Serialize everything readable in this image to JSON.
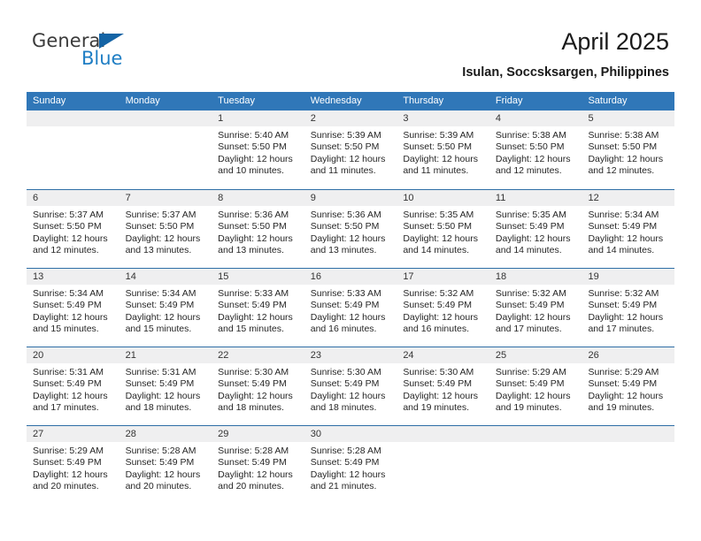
{
  "logo": {
    "primary_text": "General",
    "secondary_text": "Blue",
    "primary_color": "#3b3b3b",
    "secondary_color": "#1f7ec4",
    "triangle_color": "#1464a5"
  },
  "header": {
    "title": "April 2025",
    "subtitle": "Isulan, Soccsksargen, Philippines"
  },
  "theme": {
    "header_row_bg": "#3077b8",
    "header_row_text": "#ffffff",
    "week_divider": "#2e6ea6",
    "daynum_bg": "#efeff0",
    "cell_bg": "#ffffff"
  },
  "calendar": {
    "weekday_headers": [
      "Sunday",
      "Monday",
      "Tuesday",
      "Wednesday",
      "Thursday",
      "Friday",
      "Saturday"
    ],
    "weeks": [
      [
        {
          "day": "",
          "sunrise": "",
          "sunset": "",
          "daylight": "",
          "daylight2": ""
        },
        {
          "day": "",
          "sunrise": "",
          "sunset": "",
          "daylight": "",
          "daylight2": ""
        },
        {
          "day": "1",
          "sunrise": "Sunrise: 5:40 AM",
          "sunset": "Sunset: 5:50 PM",
          "daylight": "Daylight: 12 hours",
          "daylight2": "and 10 minutes."
        },
        {
          "day": "2",
          "sunrise": "Sunrise: 5:39 AM",
          "sunset": "Sunset: 5:50 PM",
          "daylight": "Daylight: 12 hours",
          "daylight2": "and 11 minutes."
        },
        {
          "day": "3",
          "sunrise": "Sunrise: 5:39 AM",
          "sunset": "Sunset: 5:50 PM",
          "daylight": "Daylight: 12 hours",
          "daylight2": "and 11 minutes."
        },
        {
          "day": "4",
          "sunrise": "Sunrise: 5:38 AM",
          "sunset": "Sunset: 5:50 PM",
          "daylight": "Daylight: 12 hours",
          "daylight2": "and 12 minutes."
        },
        {
          "day": "5",
          "sunrise": "Sunrise: 5:38 AM",
          "sunset": "Sunset: 5:50 PM",
          "daylight": "Daylight: 12 hours",
          "daylight2": "and 12 minutes."
        }
      ],
      [
        {
          "day": "6",
          "sunrise": "Sunrise: 5:37 AM",
          "sunset": "Sunset: 5:50 PM",
          "daylight": "Daylight: 12 hours",
          "daylight2": "and 12 minutes."
        },
        {
          "day": "7",
          "sunrise": "Sunrise: 5:37 AM",
          "sunset": "Sunset: 5:50 PM",
          "daylight": "Daylight: 12 hours",
          "daylight2": "and 13 minutes."
        },
        {
          "day": "8",
          "sunrise": "Sunrise: 5:36 AM",
          "sunset": "Sunset: 5:50 PM",
          "daylight": "Daylight: 12 hours",
          "daylight2": "and 13 minutes."
        },
        {
          "day": "9",
          "sunrise": "Sunrise: 5:36 AM",
          "sunset": "Sunset: 5:50 PM",
          "daylight": "Daylight: 12 hours",
          "daylight2": "and 13 minutes."
        },
        {
          "day": "10",
          "sunrise": "Sunrise: 5:35 AM",
          "sunset": "Sunset: 5:50 PM",
          "daylight": "Daylight: 12 hours",
          "daylight2": "and 14 minutes."
        },
        {
          "day": "11",
          "sunrise": "Sunrise: 5:35 AM",
          "sunset": "Sunset: 5:49 PM",
          "daylight": "Daylight: 12 hours",
          "daylight2": "and 14 minutes."
        },
        {
          "day": "12",
          "sunrise": "Sunrise: 5:34 AM",
          "sunset": "Sunset: 5:49 PM",
          "daylight": "Daylight: 12 hours",
          "daylight2": "and 14 minutes."
        }
      ],
      [
        {
          "day": "13",
          "sunrise": "Sunrise: 5:34 AM",
          "sunset": "Sunset: 5:49 PM",
          "daylight": "Daylight: 12 hours",
          "daylight2": "and 15 minutes."
        },
        {
          "day": "14",
          "sunrise": "Sunrise: 5:34 AM",
          "sunset": "Sunset: 5:49 PM",
          "daylight": "Daylight: 12 hours",
          "daylight2": "and 15 minutes."
        },
        {
          "day": "15",
          "sunrise": "Sunrise: 5:33 AM",
          "sunset": "Sunset: 5:49 PM",
          "daylight": "Daylight: 12 hours",
          "daylight2": "and 15 minutes."
        },
        {
          "day": "16",
          "sunrise": "Sunrise: 5:33 AM",
          "sunset": "Sunset: 5:49 PM",
          "daylight": "Daylight: 12 hours",
          "daylight2": "and 16 minutes."
        },
        {
          "day": "17",
          "sunrise": "Sunrise: 5:32 AM",
          "sunset": "Sunset: 5:49 PM",
          "daylight": "Daylight: 12 hours",
          "daylight2": "and 16 minutes."
        },
        {
          "day": "18",
          "sunrise": "Sunrise: 5:32 AM",
          "sunset": "Sunset: 5:49 PM",
          "daylight": "Daylight: 12 hours",
          "daylight2": "and 17 minutes."
        },
        {
          "day": "19",
          "sunrise": "Sunrise: 5:32 AM",
          "sunset": "Sunset: 5:49 PM",
          "daylight": "Daylight: 12 hours",
          "daylight2": "and 17 minutes."
        }
      ],
      [
        {
          "day": "20",
          "sunrise": "Sunrise: 5:31 AM",
          "sunset": "Sunset: 5:49 PM",
          "daylight": "Daylight: 12 hours",
          "daylight2": "and 17 minutes."
        },
        {
          "day": "21",
          "sunrise": "Sunrise: 5:31 AM",
          "sunset": "Sunset: 5:49 PM",
          "daylight": "Daylight: 12 hours",
          "daylight2": "and 18 minutes."
        },
        {
          "day": "22",
          "sunrise": "Sunrise: 5:30 AM",
          "sunset": "Sunset: 5:49 PM",
          "daylight": "Daylight: 12 hours",
          "daylight2": "and 18 minutes."
        },
        {
          "day": "23",
          "sunrise": "Sunrise: 5:30 AM",
          "sunset": "Sunset: 5:49 PM",
          "daylight": "Daylight: 12 hours",
          "daylight2": "and 18 minutes."
        },
        {
          "day": "24",
          "sunrise": "Sunrise: 5:30 AM",
          "sunset": "Sunset: 5:49 PM",
          "daylight": "Daylight: 12 hours",
          "daylight2": "and 19 minutes."
        },
        {
          "day": "25",
          "sunrise": "Sunrise: 5:29 AM",
          "sunset": "Sunset: 5:49 PM",
          "daylight": "Daylight: 12 hours",
          "daylight2": "and 19 minutes."
        },
        {
          "day": "26",
          "sunrise": "Sunrise: 5:29 AM",
          "sunset": "Sunset: 5:49 PM",
          "daylight": "Daylight: 12 hours",
          "daylight2": "and 19 minutes."
        }
      ],
      [
        {
          "day": "27",
          "sunrise": "Sunrise: 5:29 AM",
          "sunset": "Sunset: 5:49 PM",
          "daylight": "Daylight: 12 hours",
          "daylight2": "and 20 minutes."
        },
        {
          "day": "28",
          "sunrise": "Sunrise: 5:28 AM",
          "sunset": "Sunset: 5:49 PM",
          "daylight": "Daylight: 12 hours",
          "daylight2": "and 20 minutes."
        },
        {
          "day": "29",
          "sunrise": "Sunrise: 5:28 AM",
          "sunset": "Sunset: 5:49 PM",
          "daylight": "Daylight: 12 hours",
          "daylight2": "and 20 minutes."
        },
        {
          "day": "30",
          "sunrise": "Sunrise: 5:28 AM",
          "sunset": "Sunset: 5:49 PM",
          "daylight": "Daylight: 12 hours",
          "daylight2": "and 21 minutes."
        },
        {
          "day": "",
          "sunrise": "",
          "sunset": "",
          "daylight": "",
          "daylight2": ""
        },
        {
          "day": "",
          "sunrise": "",
          "sunset": "",
          "daylight": "",
          "daylight2": ""
        },
        {
          "day": "",
          "sunrise": "",
          "sunset": "",
          "daylight": "",
          "daylight2": ""
        }
      ]
    ]
  }
}
